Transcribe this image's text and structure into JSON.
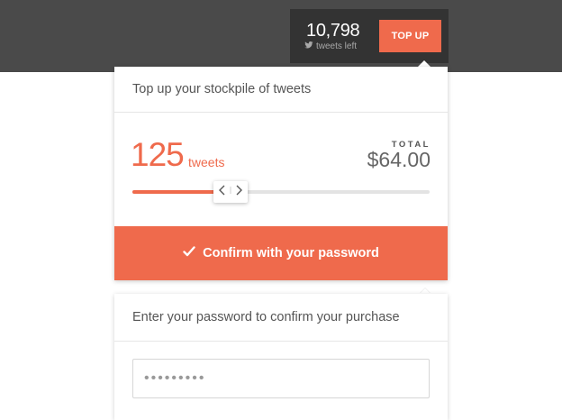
{
  "balance": {
    "count": "10,798",
    "sub_label": "tweets left",
    "icon": "twitter-bird-icon",
    "topup_label": "TOP UP"
  },
  "purchase": {
    "header": "Top up your stockpile of tweets",
    "quantity": "125",
    "quantity_unit": "tweets",
    "total_label": "TOTAL",
    "total_value": "$64.00",
    "slider_fraction": 0.33,
    "confirm_label": "Confirm with your password",
    "confirm_icon": "checkmark-icon"
  },
  "password": {
    "header": "Enter your password to confirm your purchase",
    "value": "•••••••••"
  },
  "colors": {
    "accent": "#ef6a4c",
    "topbar": "#4a4a4a",
    "counter_bg": "#333333"
  }
}
